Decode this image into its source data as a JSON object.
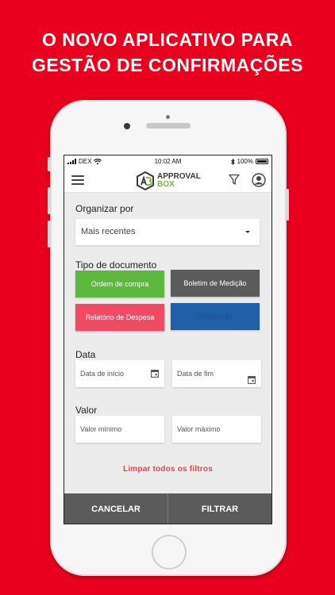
{
  "headline": {
    "line1": "O NOVO APLICATIVO PARA",
    "line2": "GESTÃO DE CONFIRMAÇÕES"
  },
  "status_bar": {
    "carrier": "DEX",
    "time": "10:02 AM",
    "battery": "100%"
  },
  "app_bar": {
    "logo_line1": "APPROVAL",
    "logo_line2": "BOX",
    "icons": [
      "menu-icon",
      "filter-icon",
      "user-icon"
    ]
  },
  "filters": {
    "sort": {
      "label": "Organizar por",
      "selected": "Mais recentes"
    },
    "document_type": {
      "label": "Tipo de documento",
      "options": [
        {
          "label": "Ordem de compra",
          "color": "#5cb83e"
        },
        {
          "label": "Boletim de Medição",
          "color": "#5b5b5b"
        },
        {
          "label": "Relatório de Despesa",
          "color": "#f04b62"
        },
        {
          "label": "Requisição",
          "color": "#1f5fa8"
        }
      ]
    },
    "date": {
      "label": "Data",
      "start_placeholder": "Data de início",
      "end_placeholder": "Data de fim"
    },
    "value": {
      "label": "Valor",
      "min_placeholder": "Valor mínimo",
      "max_placeholder": "Valor máximo"
    },
    "clear_all": "Limpar todos os filtros"
  },
  "footer": {
    "cancel": "CANCELAR",
    "apply": "FILTRAR"
  },
  "colors": {
    "background": "#e8001e",
    "footer": "#5b5b5b",
    "link": "#e2454f",
    "logo_accent": "#7cb342"
  }
}
